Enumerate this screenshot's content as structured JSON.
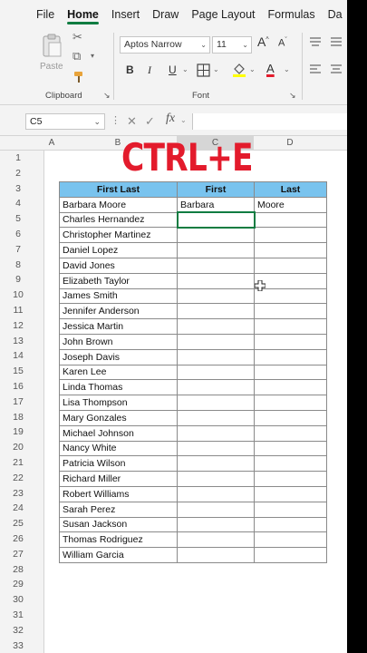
{
  "menu": {
    "tabs": [
      "File",
      "Home",
      "Insert",
      "Draw",
      "Page Layout",
      "Formulas",
      "Da"
    ],
    "active": "Home"
  },
  "ribbon": {
    "clipboard": {
      "paste_label": "Paste",
      "group_label": "Clipboard"
    },
    "font": {
      "font_name": "Aptos Narrow",
      "font_size": "11",
      "grow_label": "A",
      "shrink_label": "A",
      "bold": "B",
      "italic": "I",
      "underline": "U",
      "font_color_letter": "A",
      "group_label": "Font",
      "font_color": "#e31b2c",
      "fill_color": "#ffff00"
    }
  },
  "formula_bar": {
    "name_box": "C5",
    "fx_label": "fx",
    "value": ""
  },
  "grid": {
    "columns": [
      "A",
      "B",
      "C",
      "D"
    ],
    "row_numbers": [
      1,
      2,
      3,
      4,
      5,
      6,
      7,
      8,
      9,
      10,
      11,
      12,
      13,
      14,
      15,
      16,
      17,
      18,
      19,
      20,
      21,
      22,
      23,
      24,
      25,
      26,
      27,
      28,
      29,
      30,
      31,
      32,
      33
    ],
    "selected_cell": "C5"
  },
  "overlay": {
    "banner_text": "CTRL+E"
  },
  "table": {
    "headers": [
      "First Last",
      "First",
      "Last"
    ],
    "header_color": "#79c3ee",
    "rows": [
      [
        "Barbara Moore",
        "Barbara",
        "Moore"
      ],
      [
        "Charles Hernandez",
        "",
        ""
      ],
      [
        "Christopher Martinez",
        "",
        ""
      ],
      [
        "Daniel Lopez",
        "",
        ""
      ],
      [
        "David Jones",
        "",
        ""
      ],
      [
        "Elizabeth Taylor",
        "",
        ""
      ],
      [
        "James Smith",
        "",
        ""
      ],
      [
        "Jennifer Anderson",
        "",
        ""
      ],
      [
        "Jessica Martin",
        "",
        ""
      ],
      [
        "John Brown",
        "",
        ""
      ],
      [
        "Joseph Davis",
        "",
        ""
      ],
      [
        "Karen Lee",
        "",
        ""
      ],
      [
        "Linda Thomas",
        "",
        ""
      ],
      [
        "Lisa Thompson",
        "",
        ""
      ],
      [
        "Mary Gonzales",
        "",
        ""
      ],
      [
        "Michael Johnson",
        "",
        ""
      ],
      [
        "Nancy White",
        "",
        ""
      ],
      [
        "Patricia Wilson",
        "",
        ""
      ],
      [
        "Richard Miller",
        "",
        ""
      ],
      [
        "Robert Williams",
        "",
        ""
      ],
      [
        "Sarah Perez",
        "",
        ""
      ],
      [
        "Susan Jackson",
        "",
        ""
      ],
      [
        "Thomas Rodriguez",
        "",
        ""
      ],
      [
        "William Garcia",
        "",
        ""
      ]
    ]
  }
}
